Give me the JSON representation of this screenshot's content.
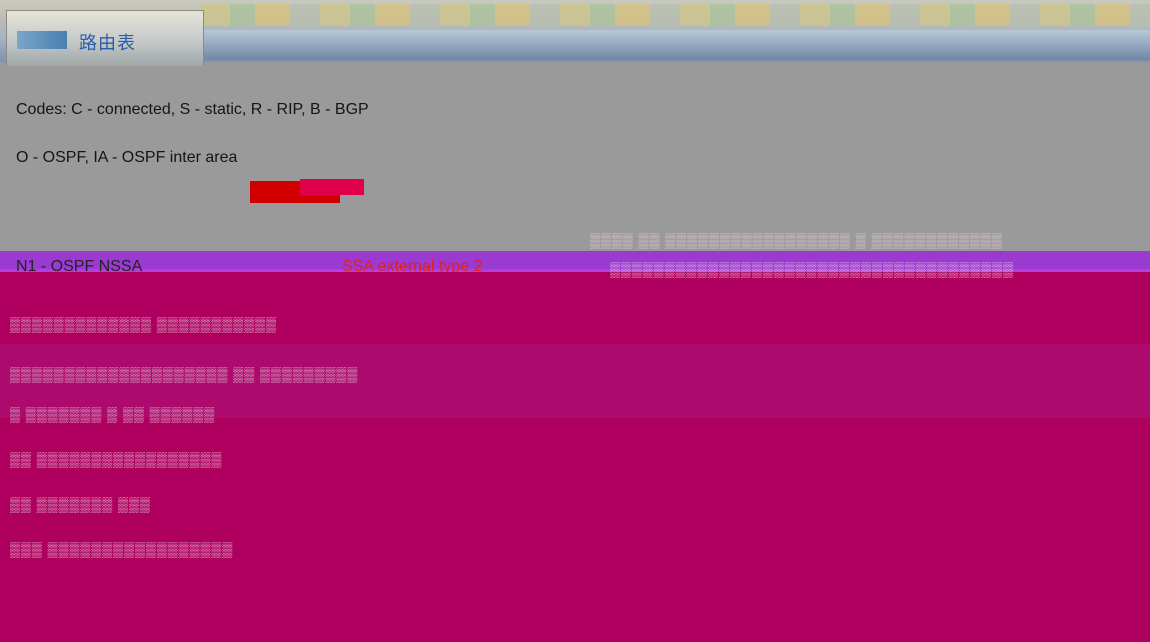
{
  "tab": {
    "title": "路由表"
  },
  "legend": {
    "line1": "Codes: C - connected, S - static, R - RIP, B - BGP",
    "line2": "O - OSPF, IA - OSPF inter area",
    "line3_start": "N1 - OSPF NSSA",
    "line3_tail": "SSA external type 2"
  },
  "colors": {
    "background": "#9a9a9a",
    "tab_text": "#2a5ea8",
    "corruption_magenta": "#b0005f",
    "corruption_purple": "#9b3ad0",
    "corruption_red": "#d00000"
  }
}
